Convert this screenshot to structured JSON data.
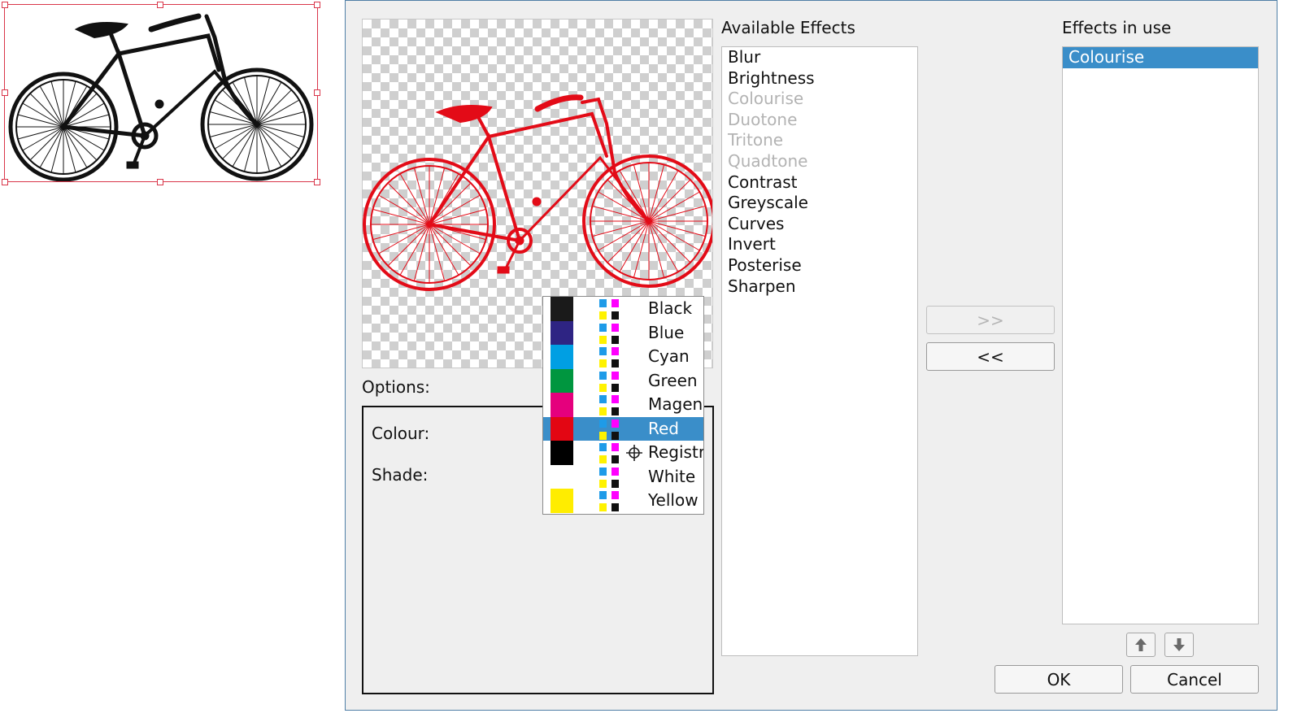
{
  "colors": {
    "accent": "#3a8ec9",
    "bike_original": "#111111",
    "bike_preview": "#e30b17"
  },
  "dialog": {
    "available_effects_label": "Available Effects",
    "effects_in_use_label": "Effects in use",
    "options_label": "Options:",
    "colour_label": "Colour:",
    "shade_label": "Shade:",
    "add_button": ">>",
    "remove_button": "<<",
    "ok_button": "OK",
    "cancel_button": "Cancel",
    "move_up_icon": "arrow-up-icon",
    "move_down_icon": "arrow-down-icon"
  },
  "available_effects": [
    {
      "label": "Blur",
      "enabled": true
    },
    {
      "label": "Brightness",
      "enabled": true
    },
    {
      "label": "Colourise",
      "enabled": false
    },
    {
      "label": "Duotone",
      "enabled": false
    },
    {
      "label": "Tritone",
      "enabled": false
    },
    {
      "label": "Quadtone",
      "enabled": false
    },
    {
      "label": "Contrast",
      "enabled": true
    },
    {
      "label": "Greyscale",
      "enabled": true
    },
    {
      "label": "Curves",
      "enabled": true
    },
    {
      "label": "Invert",
      "enabled": true
    },
    {
      "label": "Posterise",
      "enabled": true
    },
    {
      "label": "Sharpen",
      "enabled": true
    }
  ],
  "effects_in_use": [
    {
      "label": "Colourise",
      "selected": true
    }
  ],
  "colour_popup": [
    {
      "name": "Black",
      "swatch": "#1a1a1a",
      "selected": false
    },
    {
      "name": "Blue",
      "swatch": "#2e2483",
      "selected": false
    },
    {
      "name": "Cyan",
      "swatch": "#009fe3",
      "selected": false
    },
    {
      "name": "Green",
      "swatch": "#00963f",
      "selected": false
    },
    {
      "name": "Magen",
      "swatch": "#e5007d",
      "selected": false
    },
    {
      "name": "Red",
      "swatch": "#e30613",
      "selected": true
    },
    {
      "name": "Registr",
      "swatch": "#000000",
      "selected": false,
      "registration": true
    },
    {
      "name": "White",
      "swatch": "#ffffff",
      "selected": false
    },
    {
      "name": "Yellow",
      "swatch": "#ffed00",
      "selected": false
    }
  ]
}
